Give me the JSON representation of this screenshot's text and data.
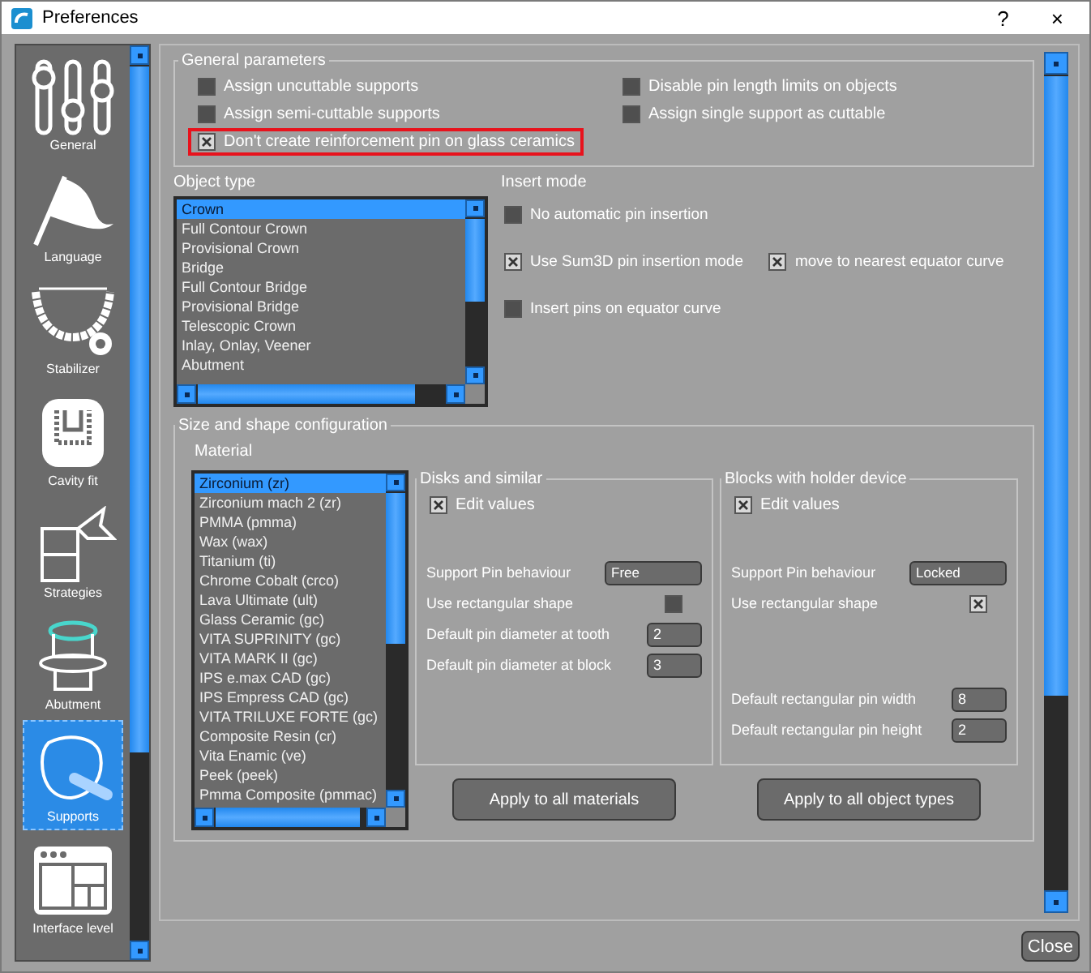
{
  "window": {
    "title": "Preferences",
    "help": "?",
    "close": "×"
  },
  "sidebar": {
    "items": [
      {
        "label": "General",
        "kind": "sliders",
        "selected": false
      },
      {
        "label": "Language",
        "kind": "flag",
        "selected": false
      },
      {
        "label": "Stabilizer",
        "kind": "stabilizer",
        "selected": false
      },
      {
        "label": "Cavity fit",
        "kind": "cavity",
        "selected": false
      },
      {
        "label": "Strategies",
        "kind": "strategies",
        "selected": false
      },
      {
        "label": "Abutment",
        "kind": "abutment",
        "selected": false
      },
      {
        "label": "Supports",
        "kind": "supports",
        "selected": true
      },
      {
        "label": "Interface level",
        "kind": "layout",
        "selected": false
      }
    ]
  },
  "general_parameters": {
    "title": "General parameters",
    "left_options": [
      {
        "label": "Assign uncuttable supports",
        "checked": false,
        "highlighted": false
      },
      {
        "label": "Assign semi-cuttable supports",
        "checked": false,
        "highlighted": false
      },
      {
        "label": "Don't create reinforcement pin on glass ceramics",
        "checked": true,
        "highlighted": true
      }
    ],
    "right_options": [
      {
        "label": "Disable pin length limits on objects",
        "checked": false,
        "highlighted": false
      },
      {
        "label": "Assign single support as cuttable",
        "checked": false,
        "highlighted": false
      }
    ]
  },
  "object_type": {
    "label": "Object type",
    "items": [
      {
        "label": "Crown",
        "selected": true
      },
      {
        "label": "Full Contour Crown",
        "selected": false
      },
      {
        "label": "Provisional Crown",
        "selected": false
      },
      {
        "label": "Bridge",
        "selected": false
      },
      {
        "label": "Full Contour Bridge",
        "selected": false
      },
      {
        "label": "Provisional Bridge",
        "selected": false
      },
      {
        "label": "Telescopic Crown",
        "selected": false
      },
      {
        "label": "Inlay, Onlay, Veener",
        "selected": false
      },
      {
        "label": "Abutment",
        "selected": false
      }
    ]
  },
  "insert_mode": {
    "label": "Insert mode",
    "rows": [
      [
        {
          "label": "No automatic pin insertion",
          "checked": false
        }
      ],
      [
        {
          "label": "Use Sum3D pin insertion mode",
          "checked": true
        },
        {
          "label": "move to nearest equator curve",
          "checked": true
        }
      ],
      [
        {
          "label": "Insert pins on equator curve",
          "checked": false
        }
      ]
    ]
  },
  "size_shape": {
    "title": "Size and shape configuration",
    "material_label": "Material",
    "materials": [
      {
        "label": "Zirconium (zr)",
        "selected": true
      },
      {
        "label": "Zirconium mach 2 (zr)",
        "selected": false
      },
      {
        "label": "PMMA (pmma)",
        "selected": false
      },
      {
        "label": "Wax (wax)",
        "selected": false
      },
      {
        "label": "Titanium (ti)",
        "selected": false
      },
      {
        "label": "Chrome Cobalt (crco)",
        "selected": false
      },
      {
        "label": "Lava Ultimate (ult)",
        "selected": false
      },
      {
        "label": "Glass Ceramic (gc)",
        "selected": false
      },
      {
        "label": "VITA SUPRINITY (gc)",
        "selected": false
      },
      {
        "label": "VITA MARK II (gc)",
        "selected": false
      },
      {
        "label": "IPS e.max CAD (gc)",
        "selected": false
      },
      {
        "label": "IPS Empress CAD (gc)",
        "selected": false
      },
      {
        "label": "VITA TRILUXE FORTE (gc)",
        "selected": false
      },
      {
        "label": "Composite Resin (cr)",
        "selected": false
      },
      {
        "label": "Vita Enamic (ve)",
        "selected": false
      },
      {
        "label": "Peek (peek)",
        "selected": false
      },
      {
        "label": "Pmma Composite (pmmac)",
        "selected": false
      }
    ],
    "groups": [
      {
        "title": "Disks and similar",
        "edit": {
          "label": "Edit values",
          "checked": true
        },
        "sections": [
          [
            {
              "kind": "select",
              "label": "Support Pin behaviour",
              "value": "Free"
            },
            {
              "kind": "checkbox",
              "label": "Use rectangular shape",
              "checked": false
            },
            {
              "kind": "input",
              "label": "Default pin diameter at tooth",
              "value": "2"
            },
            {
              "kind": "input",
              "label": "Default pin diameter at block",
              "value": "3"
            }
          ]
        ],
        "button": "Apply to all materials"
      },
      {
        "title": "Blocks with holder device",
        "edit": {
          "label": "Edit values",
          "checked": true
        },
        "sections": [
          [
            {
              "kind": "select",
              "label": "Support Pin behaviour",
              "value": "Locked"
            },
            {
              "kind": "checkbox",
              "label": "Use rectangular shape",
              "checked": true
            }
          ],
          [
            {
              "kind": "input",
              "label": "Default rectangular pin width",
              "value": "8"
            },
            {
              "kind": "input",
              "label": "Default rectangular pin height",
              "value": "2"
            }
          ]
        ],
        "button": "Apply to all object types"
      }
    ]
  },
  "close_button": "Close"
}
